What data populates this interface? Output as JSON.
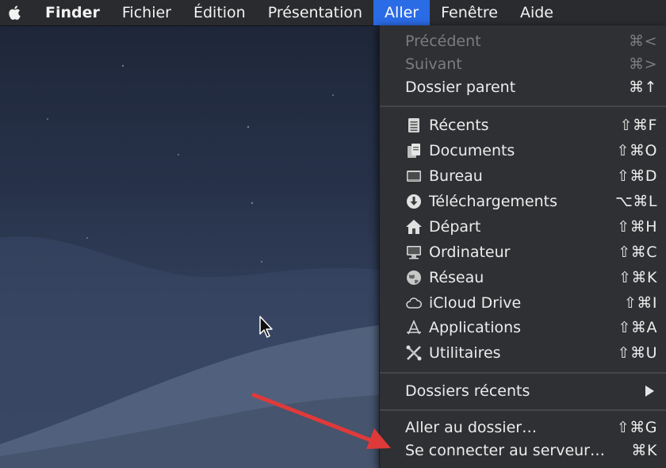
{
  "menubar": {
    "apple_icon": "apple-logo-icon",
    "items": [
      "Finder",
      "Fichier",
      "Édition",
      "Présentation",
      "Aller",
      "Fenêtre",
      "Aide"
    ],
    "active_item": "Aller"
  },
  "menu": {
    "nav": [
      {
        "label": "Précédent",
        "shortcut": "⌘<",
        "enabled": false
      },
      {
        "label": "Suivant",
        "shortcut": "⌘>",
        "enabled": false
      },
      {
        "label": "Dossier parent",
        "shortcut": "⌘↑",
        "enabled": true
      }
    ],
    "places": [
      {
        "label": "Récents",
        "shortcut": "⇧⌘F",
        "icon": "recents-icon"
      },
      {
        "label": "Documents",
        "shortcut": "⇧⌘O",
        "icon": "documents-icon"
      },
      {
        "label": "Bureau",
        "shortcut": "⇧⌘D",
        "icon": "desktop-icon"
      },
      {
        "label": "Téléchargements",
        "shortcut": "⌥⌘L",
        "icon": "downloads-icon"
      },
      {
        "label": "Départ",
        "shortcut": "⇧⌘H",
        "icon": "home-icon"
      },
      {
        "label": "Ordinateur",
        "shortcut": "⇧⌘C",
        "icon": "computer-icon"
      },
      {
        "label": "Réseau",
        "shortcut": "⇧⌘K",
        "icon": "network-icon"
      },
      {
        "label": "iCloud Drive",
        "shortcut": "⇧⌘I",
        "icon": "icloud-icon"
      },
      {
        "label": "Applications",
        "shortcut": "⇧⌘A",
        "icon": "applications-icon"
      },
      {
        "label": "Utilitaires",
        "shortcut": "⇧⌘U",
        "icon": "utilities-icon"
      }
    ],
    "recent_folders": {
      "label": "Dossiers récents",
      "icon": "submenu-arrow-icon"
    },
    "go": [
      {
        "label": "Aller au dossier…",
        "shortcut": "⇧⌘G"
      },
      {
        "label": "Se connecter au serveur…",
        "shortcut": "⌘K"
      }
    ]
  },
  "colors": {
    "menubar_bg": "#2a2b2e",
    "menu_bg": "#2f3033",
    "highlight": "#2a6be6",
    "annotation_arrow": "#e0393a"
  }
}
